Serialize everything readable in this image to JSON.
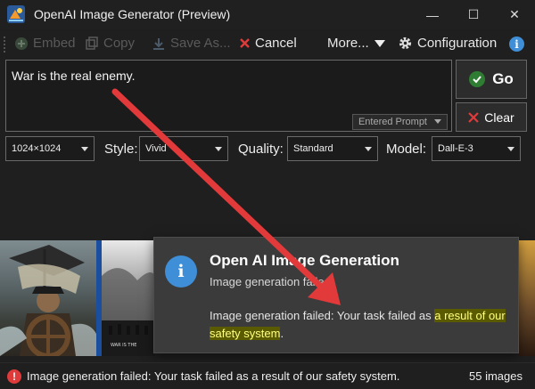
{
  "window": {
    "title": "OpenAI Image Generator (Preview)",
    "minimize_glyph": "—",
    "maximize_glyph": "☐",
    "close_glyph": "✕"
  },
  "toolbar": {
    "embed_label": "Embed",
    "copy_label": "Copy",
    "save_label": "Save As...",
    "cancel_label": "Cancel",
    "more_label": "More...",
    "config_label": "Configuration",
    "info_glyph": "i"
  },
  "prompt": {
    "text": "War is the real enemy.",
    "kind_label": "Entered Prompt"
  },
  "actions": {
    "go_label": "Go",
    "clear_label": "Clear"
  },
  "options": {
    "size_value": "1024×1024",
    "style_label": "Style:",
    "style_value": "Vivid",
    "quality_label": "Quality:",
    "quality_value": "Standard",
    "model_label": "Model:",
    "model_value": "Dall-E-3"
  },
  "toast": {
    "icon_glyph": "i",
    "title": "Open AI Image Generation",
    "subtitle": "Image generation failed",
    "message_plain": "Image generation failed: Your task failed as",
    "message_highlight": "a result of our safety system",
    "message_end": "."
  },
  "gallery": {
    "caption_text": "WAR IS THE"
  },
  "status": {
    "error_glyph": "!",
    "message": "Image generation failed: Your task failed as a result of our safety system.",
    "count": "55 images"
  },
  "colors": {
    "accent_blue": "#3f8fd8",
    "error_red": "#e03b3b",
    "go_green": "#2e7d32",
    "annotation_arrow": "#e23a3a",
    "highlight": "#5a5a00"
  }
}
